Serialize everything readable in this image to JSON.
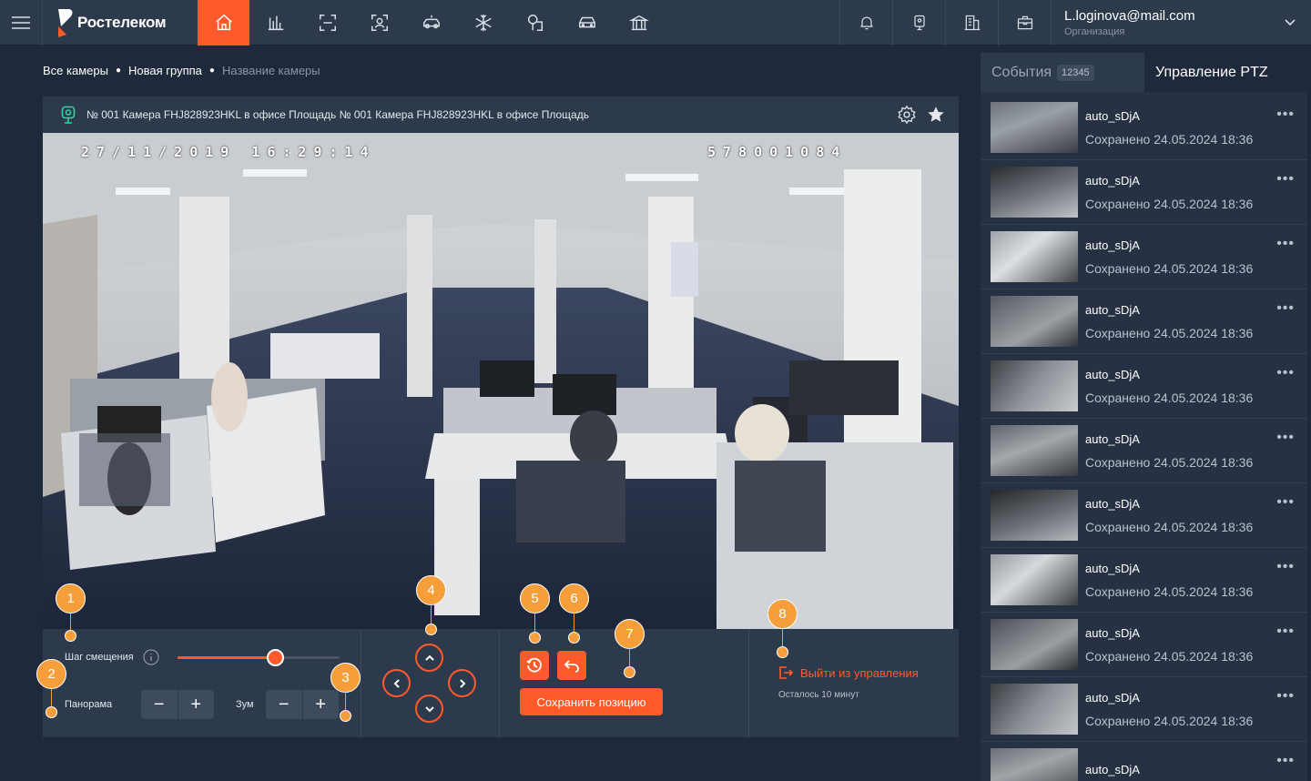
{
  "brand": {
    "name": "Ростелеком",
    "accent": "#ff5a2c"
  },
  "user": {
    "email": "L.loginova@mail.com",
    "org": "Организация"
  },
  "breadcrumb": [
    "Все камеры",
    "Новая группа",
    "Название камеры"
  ],
  "camera": {
    "title": "№ 001 Камера FHJ828923HKL в офисе Площадь № 001 Камера FHJ828923HKL в офисе Площадь",
    "osd_datetime": "27/11/2019 16:29:14",
    "osd_id": "578001084"
  },
  "controls": {
    "step_label": "Шаг смещения",
    "step_value": 0.6,
    "panorama_label": "Панорама",
    "zoom_label": "Зум",
    "minus": "−",
    "plus": "+",
    "save_label": "Сохранить позицию",
    "exit_label": "Выйти из управления",
    "time_left": "Осталось 10 минут"
  },
  "markers": [
    "1",
    "2",
    "3",
    "4",
    "5",
    "6",
    "7",
    "8"
  ],
  "sidebar": {
    "tab_events": "События",
    "events_count": "12345",
    "tab_ptz": "Управление PTZ",
    "items": [
      {
        "name": "auto_sDjA",
        "date": "Сохранено 24.05.2024 18:36"
      },
      {
        "name": "auto_sDjA",
        "date": "Сохранено 24.05.2024 18:36"
      },
      {
        "name": "auto_sDjA",
        "date": "Сохранено 24.05.2024 18:36"
      },
      {
        "name": "auto_sDjA",
        "date": "Сохранено 24.05.2024 18:36"
      },
      {
        "name": "auto_sDjA",
        "date": "Сохранено 24.05.2024 18:36"
      },
      {
        "name": "auto_sDjA",
        "date": "Сохранено 24.05.2024 18:36"
      },
      {
        "name": "auto_sDjA",
        "date": "Сохранено 24.05.2024 18:36"
      },
      {
        "name": "auto_sDjA",
        "date": "Сохранено 24.05.2024 18:36"
      },
      {
        "name": "auto_sDjA",
        "date": "Сохранено 24.05.2024 18:36"
      },
      {
        "name": "auto_sDjA",
        "date": "Сохранено 24.05.2024 18:36"
      },
      {
        "name": "auto_sDjA",
        "date": ""
      }
    ]
  }
}
